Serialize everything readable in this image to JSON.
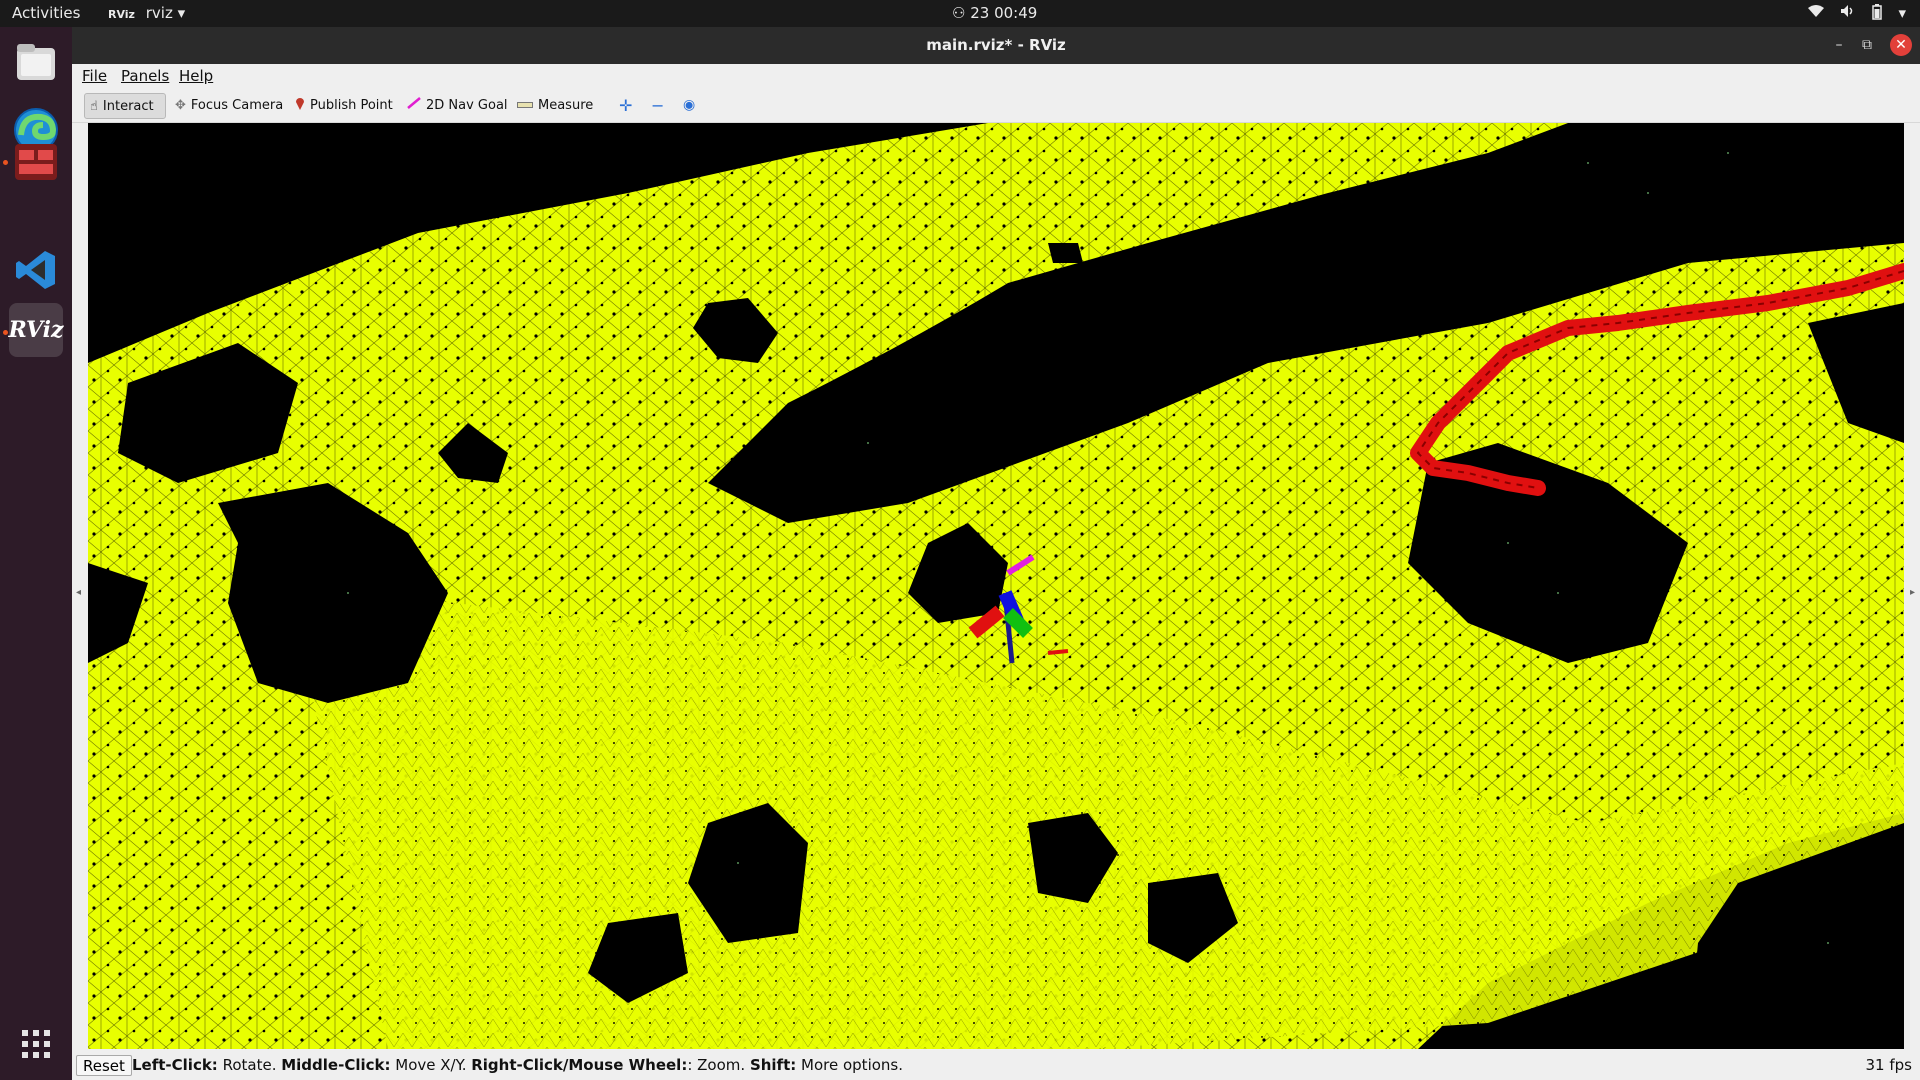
{
  "topbar": {
    "activities": "Activities",
    "app_name": "rviz",
    "app_icon_text": "RViz",
    "clock_date": "23",
    "clock_time": "00:49"
  },
  "window": {
    "title": "main.rviz* - RViz"
  },
  "menu": {
    "file": "File",
    "panels": "Panels",
    "help": "Help"
  },
  "toolbar": {
    "interact": "Interact",
    "focus_camera": "Focus Camera",
    "publish_point": "Publish Point",
    "nav_goal": "2D Nav Goal",
    "measure": "Measure"
  },
  "dock": {
    "rviz_label": "RViz"
  },
  "status": {
    "reset": "Reset",
    "left_click_key": "Left-Click:",
    "left_click_desc": " Rotate. ",
    "middle_click_key": "Middle-Click:",
    "middle_click_desc": " Move X/Y. ",
    "right_click_key": "Right-Click/Mouse Wheel:",
    "right_click_desc": ": Zoom. ",
    "shift_key": "Shift:",
    "shift_desc": " More options.",
    "fps": "31 fps"
  },
  "colors": {
    "mesh": "#e8ff00",
    "background": "#000000",
    "path": "#e01010",
    "accent": "#e95420"
  }
}
